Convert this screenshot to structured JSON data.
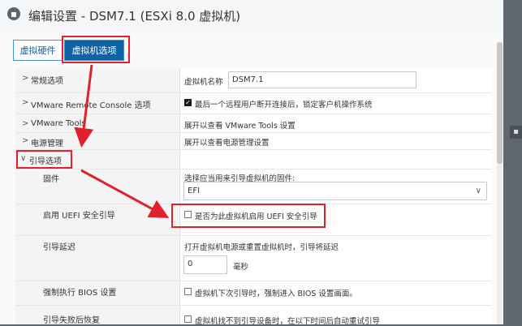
{
  "title": "编辑设置 - DSM7.1 (ESXi 8.0 虚拟机)",
  "tabs": [
    {
      "label": "虚拟硬件"
    },
    {
      "label": "虚拟机选项"
    }
  ],
  "rows": {
    "vm_name": {
      "label": "",
      "desc": "虚拟机名称",
      "value": "DSM7.1"
    },
    "general": {
      "label": "常规选项"
    },
    "remote_console": {
      "label": "VMware Remote Console 选项",
      "desc": "最后一个远程用户断开连接后，锁定客户机操作系统"
    },
    "tools": {
      "label": "VMware Tools",
      "desc": "展开以查看 VMware Tools 设置"
    },
    "power": {
      "label": "电源管理",
      "desc": "展开以查看电源管理设置"
    },
    "boot": {
      "label": "引导选项"
    },
    "firmware": {
      "label": "固件",
      "desc": "选择应当用来引导虚拟机的固件:",
      "value": "EFI"
    },
    "secure_boot": {
      "label": "启用 UEFI 安全引导",
      "desc": "是否为此虚拟机启用 UEFI 安全引导"
    },
    "boot_delay": {
      "label": "引导延迟",
      "desc": "打开虚拟机电源或重置虚拟机时，引导将延迟",
      "value": "0",
      "unit": "毫秒"
    },
    "force_bios": {
      "label": "强制执行 BIOS 设置",
      "desc": "虚拟机下次引导时，强制进入 BIOS 设置画面。"
    },
    "boot_retry": {
      "label": "引导失败后恢复",
      "desc": "虚拟机找不到引导设备时，在以下时间后自动重试引导"
    }
  },
  "colors": {
    "accent": "#0e63a7",
    "highlight": "#e0202b"
  }
}
